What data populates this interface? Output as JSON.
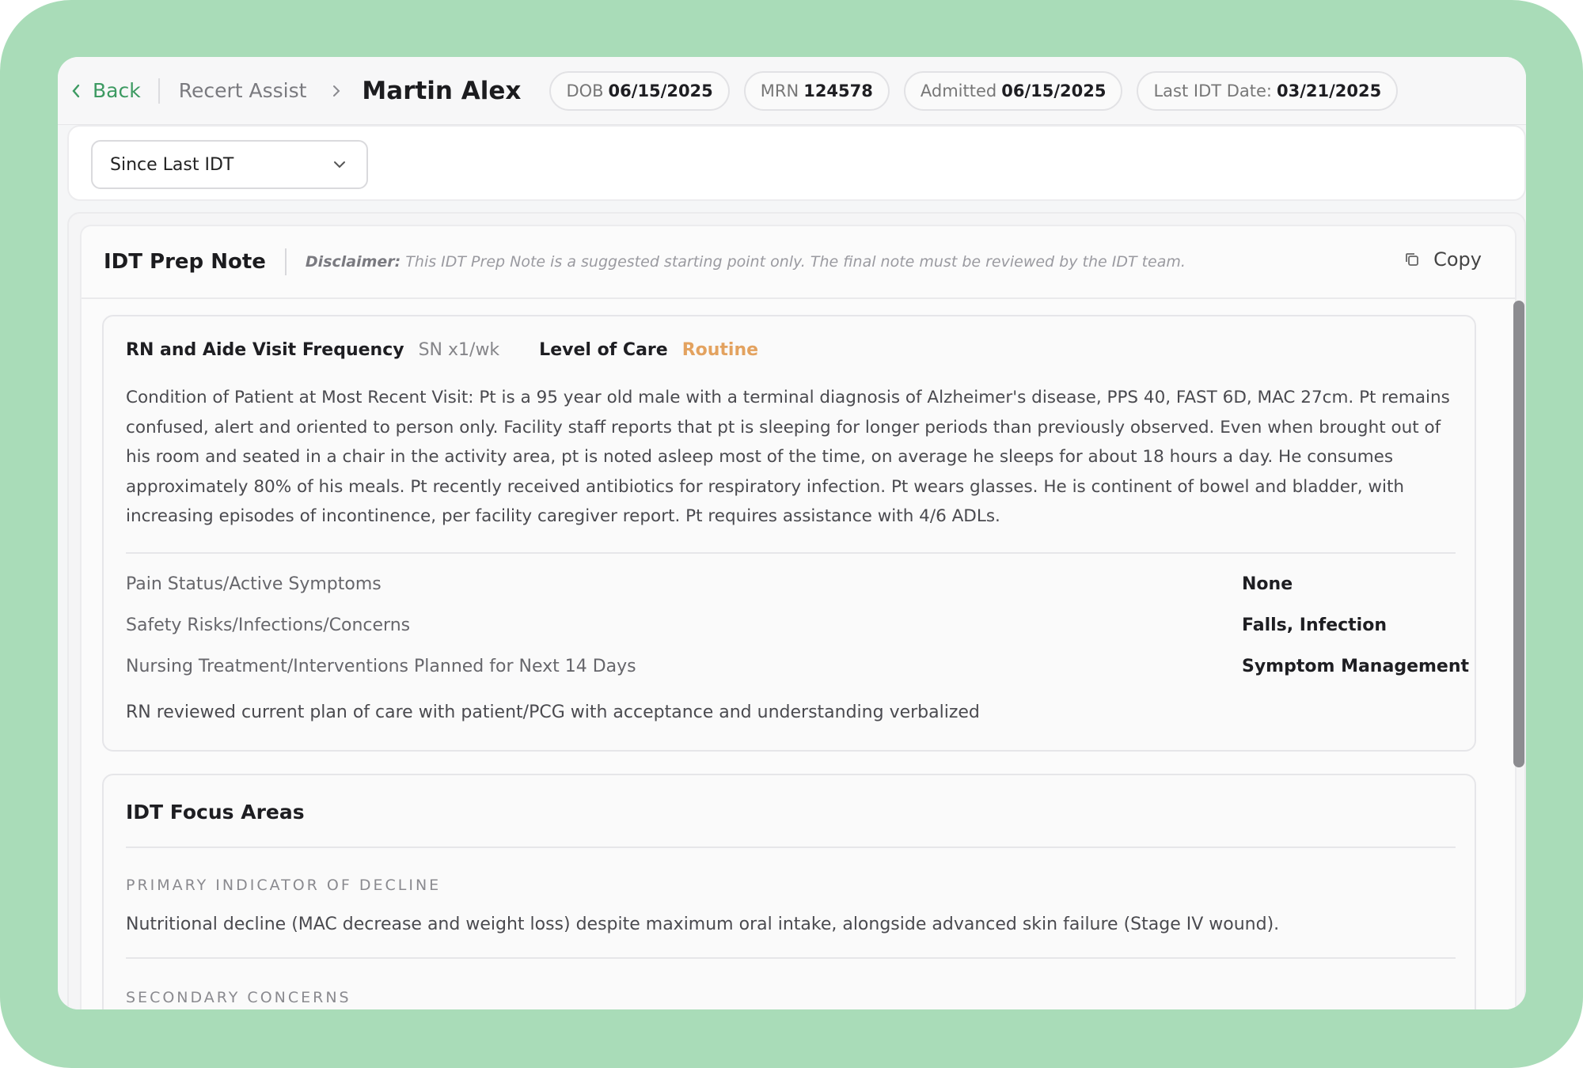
{
  "header": {
    "back_label": "Back",
    "breadcrumb": "Recert Assist",
    "patient_name": "Martin Alex",
    "pills": [
      {
        "label": "DOB",
        "value": "06/15/2025"
      },
      {
        "label": "MRN",
        "value": "124578"
      },
      {
        "label": "Admitted",
        "value": "06/15/2025"
      },
      {
        "label": "Last IDT Date:",
        "value": "03/21/2025"
      }
    ]
  },
  "filter": {
    "selected": "Since Last IDT"
  },
  "note": {
    "title": "IDT Prep Note",
    "disclaimer_label": "Disclaimer:",
    "disclaimer_text": "This IDT Prep Note is a suggested starting point only. The final note must be reviewed by the IDT team.",
    "copy_label": "Copy",
    "frequency": {
      "label": "RN and Aide Visit Frequency",
      "value": "SN x1/wk",
      "level_label": "Level of Care",
      "level_value": "Routine"
    },
    "condition": "Condition of Patient at Most Recent Visit: Pt is a 95 year old male with a terminal diagnosis of Alzheimer's disease, PPS 40, FAST 6D, MAC 27cm. Pt remains confused, alert and oriented to person only. Facility staff reports that pt is sleeping for longer periods than previously observed. Even when brought out of his room and seated in a chair in the activity area, pt is noted asleep most of the time, on average he sleeps for about 18 hours a day. He consumes approximately 80% of his meals. Pt recently received antibiotics for respiratory infection. Pt wears glasses. He is continent of bowel and bladder, with increasing episodes of incontinence, per facility caregiver report. Pt requires assistance with 4/6 ADLs.",
    "details": [
      {
        "key": "Pain Status/Active Symptoms",
        "value": "None"
      },
      {
        "key": "Safety Risks/Infections/Concerns",
        "value": "Falls, Infection"
      },
      {
        "key": "Nursing Treatment/Interventions Planned for Next 14 Days",
        "value": "Symptom Management"
      }
    ],
    "rn_review": "RN reviewed current plan of care with patient/PCG with acceptance and understanding verbalized"
  },
  "focus": {
    "title": "IDT Focus Areas",
    "primary_label": "PRIMARY INDICATOR OF DECLINE",
    "primary_text": "Nutritional decline (MAC decrease and weight loss) despite maximum oral intake, alongside advanced skin failure (Stage IV wound).",
    "secondary_label": "SECONDARY CONCERNS"
  },
  "colors": {
    "frame": "#a9dcb8",
    "back_green": "#3d9a62",
    "routine_orange": "#e3a25f"
  }
}
